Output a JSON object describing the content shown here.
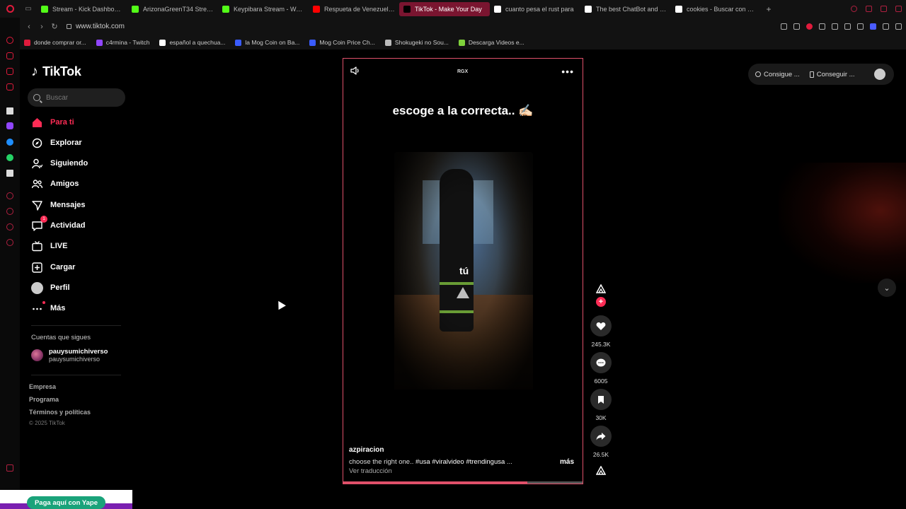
{
  "browser": {
    "tabs": [
      {
        "label": "Stream - Kick Dashboard",
        "color": "#53fc18",
        "active": false
      },
      {
        "label": "ArizonaGreenT34 Stream",
        "color": "#53fc18",
        "active": false
      },
      {
        "label": "Keypibara Stream - Wato",
        "color": "#53fc18",
        "active": false
      },
      {
        "label": "Respueta de Venezuela a",
        "color": "#ff0000",
        "active": false
      },
      {
        "label": "TikTok - Make Your Day",
        "color": "#000000",
        "active": true
      },
      {
        "label": "cuanto pesa el rust para",
        "color": "#ffffff",
        "active": false
      },
      {
        "label": "The best ChatBot and Wo",
        "color": "#ffffff",
        "active": false
      },
      {
        "label": "cookies - Buscar con Goo",
        "color": "#ffffff",
        "active": false
      }
    ],
    "url": "www.tiktok.com",
    "bookmarks": [
      {
        "label": "donde comprar or...",
        "color": "#e01b3c"
      },
      {
        "label": "c4rmina - Twitch",
        "color": "#9146ff"
      },
      {
        "label": "español a quechua...",
        "color": "#ffffff"
      },
      {
        "label": "la Mog Coin on Ba...",
        "color": "#3a5cff"
      },
      {
        "label": "Mog Coin Price Ch...",
        "color": "#3a5cff"
      },
      {
        "label": "Shokugeki no Sou...",
        "color": "#bbbbbb"
      },
      {
        "label": "Descarga Videos e...",
        "color": "#7fd13b"
      }
    ]
  },
  "tiktok": {
    "logo": "TikTok",
    "search_placeholder": "Buscar",
    "nav": {
      "para_ti": "Para ti",
      "explorar": "Explorar",
      "siguiendo": "Siguiendo",
      "amigos": "Amigos",
      "mensajes": "Mensajes",
      "actividad": "Actividad",
      "actividad_badge": "1",
      "live": "LIVE",
      "cargar": "Cargar",
      "perfil": "Perfil",
      "mas": "Más"
    },
    "following_title": "Cuentas que sigues",
    "following": [
      {
        "name": "pauysumichiverso",
        "handle": "pauysumichiverso"
      }
    ],
    "footer": {
      "empresa": "Empresa",
      "programa": "Programa",
      "terminos": "Términos y políticas",
      "copyright": "© 2025 TikTok"
    },
    "accent_color": "#fe2c55"
  },
  "video": {
    "watermark": "RGX",
    "caption_top": "escoge a la correcta.. ✍🏻",
    "overlay_label": "tú",
    "author": "azpiracion",
    "description": "choose the right one..",
    "hashtags": [
      "#usa",
      "#viralvideo",
      "#trendingusa"
    ],
    "ellipsis": "...",
    "more": "más",
    "translate": "Ver traducción",
    "progress_percent": 77
  },
  "actions": {
    "likes": "245.3K",
    "comments": "6005",
    "saves": "30K",
    "shares": "26.5K"
  },
  "top_right": {
    "coins": "Consigue ...",
    "app": "Conseguir ..."
  },
  "promo": {
    "button": "Paga aquí con Yape"
  }
}
